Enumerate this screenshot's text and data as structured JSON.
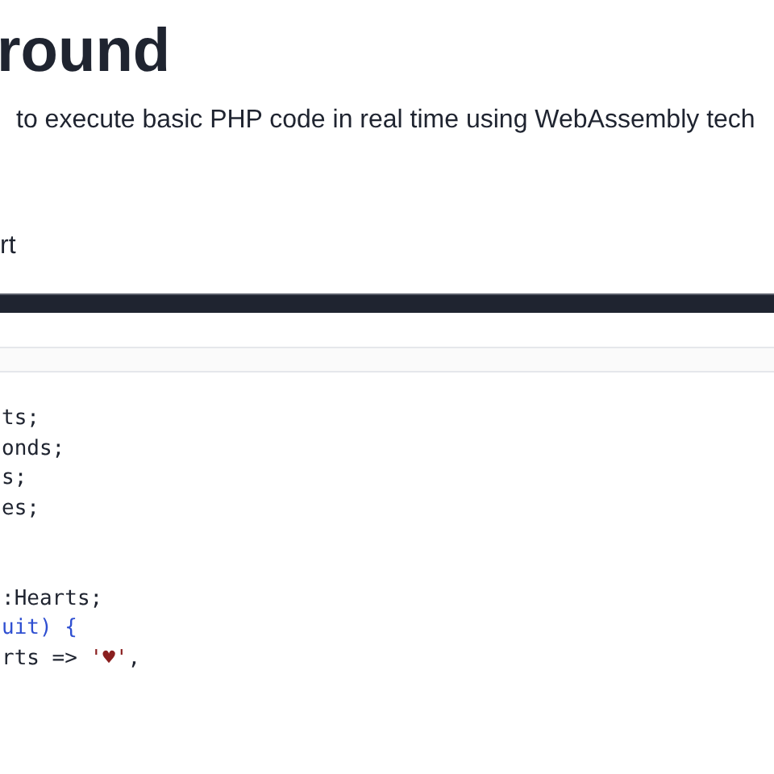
{
  "heading": "round",
  "description": "to execute basic PHP code in real time using WebAssembly tech",
  "link": "rt",
  "code_blocks": [
    [
      [
        {
          "kind": "plain",
          "text": "ts;"
        }
      ],
      [
        {
          "kind": "plain",
          "text": "onds;"
        }
      ],
      [
        {
          "kind": "plain",
          "text": "s;"
        }
      ],
      [
        {
          "kind": "plain",
          "text": "es;"
        }
      ]
    ],
    [
      [
        {
          "kind": "plain",
          "text": ":Hearts;"
        }
      ],
      [
        {
          "kind": "keyword",
          "text": "uit) {"
        }
      ],
      [
        {
          "kind": "plain",
          "text": "rts => "
        },
        {
          "kind": "string",
          "text": "'♥'"
        },
        {
          "kind": "plain",
          "text": ","
        }
      ]
    ]
  ]
}
